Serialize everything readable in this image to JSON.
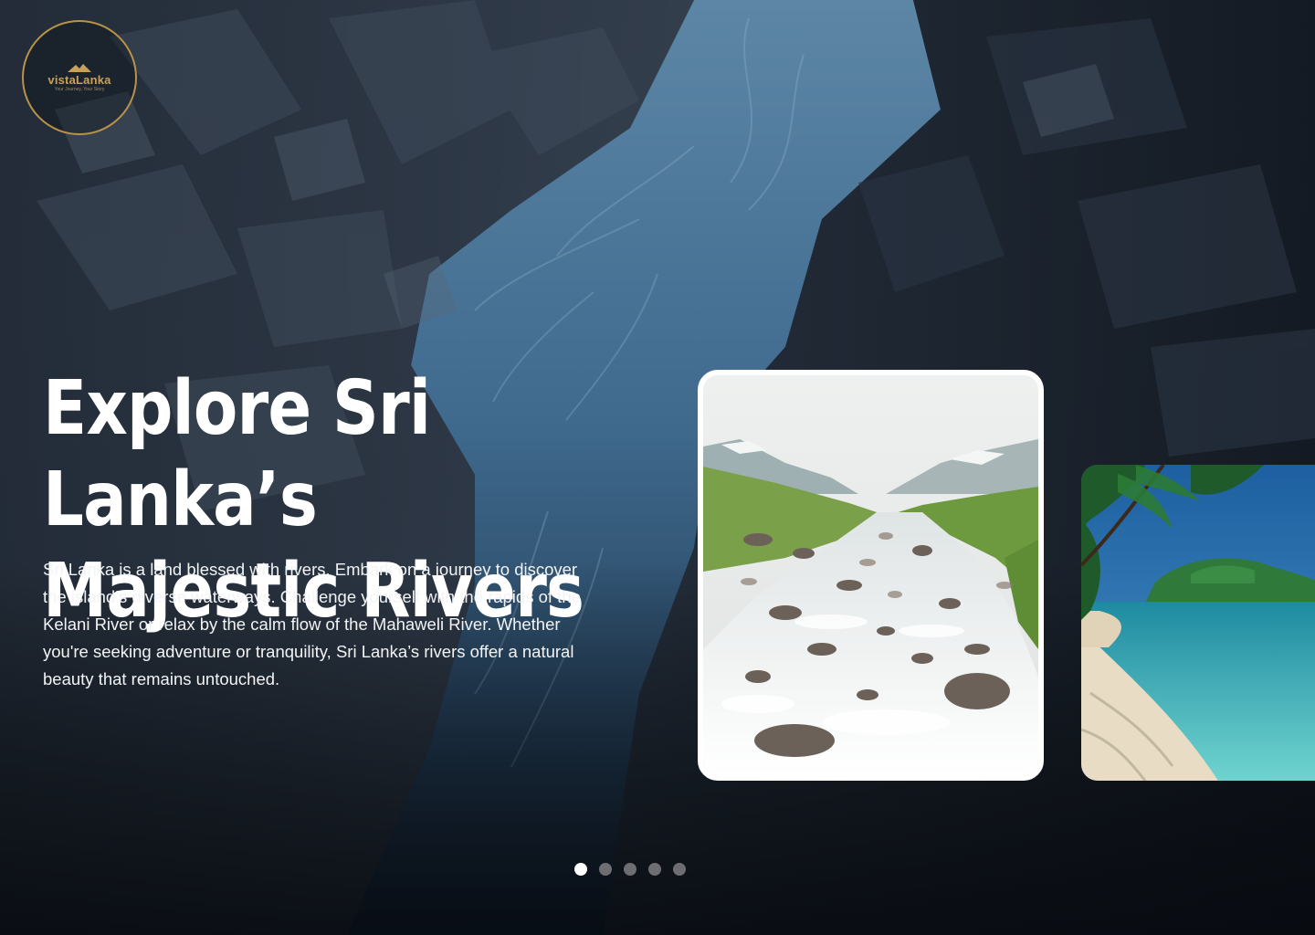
{
  "brand": {
    "name": "vistaLanka",
    "tagline": "Your Journey, Your Story",
    "accent_color": "#c9a05a"
  },
  "hero": {
    "title_line1": "Explore Sri Lanka’s",
    "title_line2": "Majestic Rivers",
    "description": "Sri Lanka is a land blessed with rivers. Embark on a journey to discover the island’s diverse waterways. Challenge yourself with the rapids of the Kelani River or relax by the calm flow of the Mahaweli River. Whether you're seeking adventure or tranquility, Sri Lanka’s rivers offer a natural beauty that remains untouched."
  },
  "carousel": {
    "cards": [
      {
        "image": "mountain-river-photo",
        "active": true
      },
      {
        "image": "tropical-beach-photo",
        "active": false
      }
    ],
    "pagination": {
      "total": 5,
      "active_index": 0
    }
  },
  "colors": {
    "text": "#ffffff",
    "dot_active": "#ffffff",
    "dot_inactive": "#6e6e72"
  }
}
